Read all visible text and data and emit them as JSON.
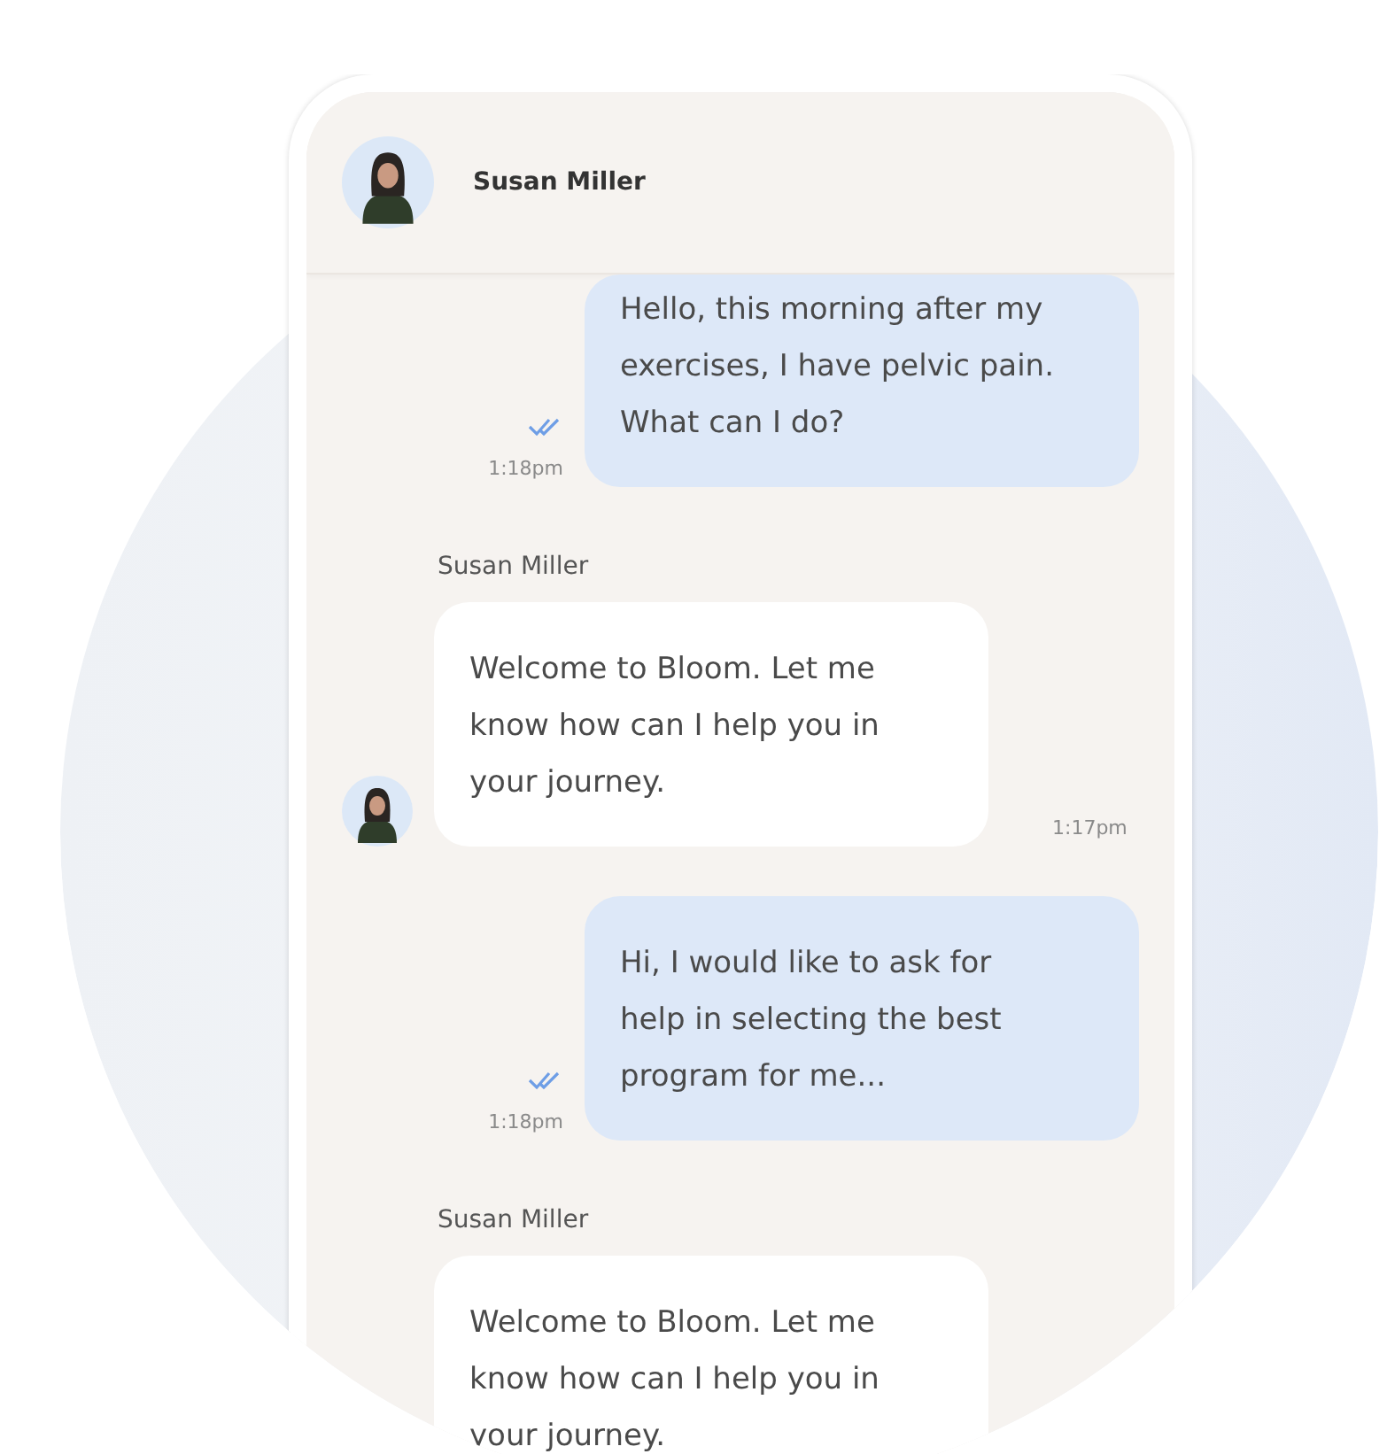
{
  "header": {
    "name": "Susan Miller"
  },
  "messages": [
    {
      "kind": "outgoing",
      "text": "Hello, this morning after my exercises, I have pelvic pain. What can I do?",
      "time": "1:18pm",
      "read": true
    },
    {
      "kind": "incoming",
      "sender": "Susan Miller",
      "text": "Welcome to Bloom. Let me know how can I help you in your journey.",
      "time": "1:17pm",
      "avatar": true
    },
    {
      "kind": "outgoing",
      "text": "Hi, I would like to ask for help in selecting the best program for me...",
      "time": "1:18pm",
      "read": true
    },
    {
      "kind": "incoming",
      "sender": "Susan Miller",
      "text": "Welcome to Bloom. Let me know how can I help you in your journey.",
      "avatar": false
    }
  ]
}
